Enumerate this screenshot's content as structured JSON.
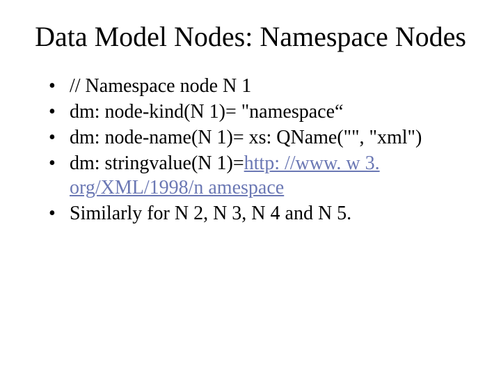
{
  "title": "Data Model Nodes: Namespace Nodes",
  "bullets": {
    "b1": "// Namespace node N 1",
    "b2": "dm: node-kind(N 1)= \"namespace“",
    "b3": "dm: node-name(N 1)= xs: QName(\"\", \"xml\")",
    "b4_prefix": "dm: stringvalue(N 1)=",
    "b4_link_text": "http: //www. w 3. org/XML/1998/n amespace",
    "b4_link_href": "http://www.w3.org/XML/1998/namespace",
    "b5": "Similarly for N 2, N 3, N 4 and N 5."
  }
}
